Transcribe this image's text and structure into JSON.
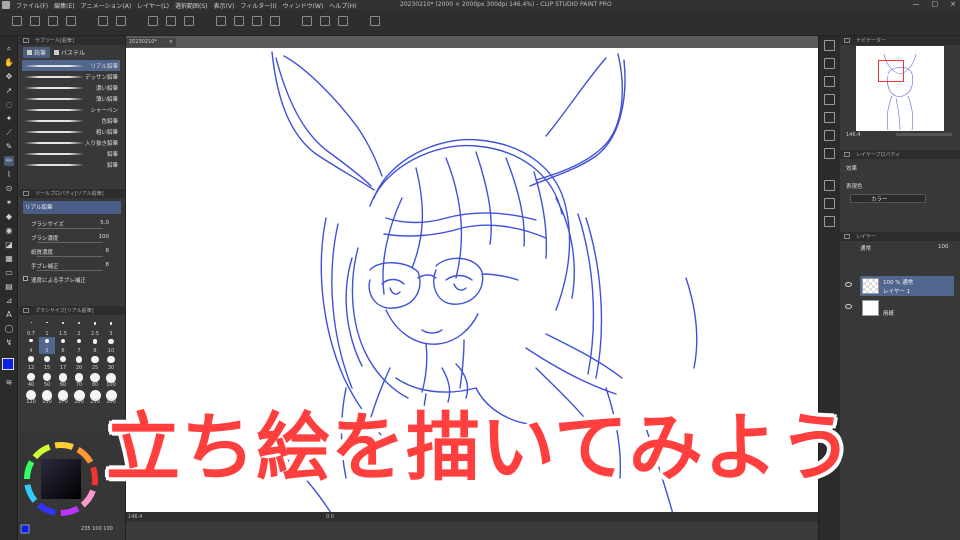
{
  "window": {
    "title": "20230210* (2000 × 2000px 300dpi 146.4%) - CLIP STUDIO PAINT PRO",
    "controls": [
      "—",
      "□",
      "×"
    ]
  },
  "menu": {
    "items": [
      "ファイル(F)",
      "編集(E)",
      "アニメーション(A)",
      "レイヤー(L)",
      "選択範囲(S)",
      "表示(V)",
      "フィルター(I)",
      "ウィンドウ(W)",
      "ヘルプ(H)"
    ]
  },
  "subtool": {
    "panel_title": "サブツール[鉛筆]",
    "tabs": [
      {
        "label": "鉛筆",
        "active": true
      },
      {
        "label": "パステル",
        "active": false
      }
    ],
    "brushes": [
      {
        "label": "リアル鉛筆",
        "active": true
      },
      {
        "label": "デッサン鉛筆",
        "active": false
      },
      {
        "label": "濃い鉛筆",
        "active": false
      },
      {
        "label": "薄い鉛筆",
        "active": false
      },
      {
        "label": "シャーペン",
        "active": false
      },
      {
        "label": "色鉛筆",
        "active": false
      },
      {
        "label": "粗い鉛筆",
        "active": false
      },
      {
        "label": "入り抜き鉛筆",
        "active": false
      },
      {
        "label": "鉛筆",
        "active": false
      },
      {
        "label": "鉛筆",
        "active": false
      }
    ]
  },
  "tool_property": {
    "panel_title": "ツールプロパティ[リアル鉛筆]",
    "preview_label": "リアル鉛筆",
    "rows": [
      {
        "label": "ブラシサイズ",
        "value": "5.0",
        "checkbox": false
      },
      {
        "label": "ブラシ濃度",
        "value": "100",
        "checkbox": false
      },
      {
        "label": "紙質濃度",
        "value": "8",
        "checkbox": false
      },
      {
        "label": "手ブレ補正",
        "value": "8",
        "checkbox": false
      },
      {
        "label": "速度による手ブレ補正",
        "value": "",
        "checkbox": true
      }
    ]
  },
  "brush_size": {
    "panel_title": "ブラシサイズ[リアル鉛筆]",
    "sizes": [
      "0.7",
      "1",
      "1.5",
      "2",
      "2.5",
      "3",
      "4",
      "5",
      "6",
      "7",
      "8",
      "10",
      "12",
      "15",
      "17",
      "20",
      "25",
      "30",
      "40",
      "50",
      "60",
      "70",
      "80",
      "100",
      "120",
      "150",
      "170",
      "200",
      "250",
      "300"
    ],
    "active_size": "5"
  },
  "color": {
    "main": "#0a20e8",
    "sub": "#ffffff",
    "values": "235 100 100"
  },
  "canvas": {
    "doc_tab": "20230210*",
    "zoom": "146.4",
    "sketch_color": "#2b3fd6"
  },
  "navigator": {
    "panel_title": "ナビゲーター",
    "zoom": "146.4",
    "angle": "0.0"
  },
  "layer_property": {
    "panel_title": "レイヤープロパティ",
    "effect_label": "効果",
    "express_label": "表現色",
    "express_value": "カラー"
  },
  "layers": {
    "panel_title": "レイヤー",
    "blend_mode": "通常",
    "opacity": "100",
    "items": [
      {
        "line1": "100 % 通常",
        "line2": "レイヤー 1",
        "active": true,
        "thumb": "checker"
      },
      {
        "line1": "",
        "line2": "用紙",
        "active": false,
        "thumb": "white"
      }
    ]
  },
  "caption": {
    "text": "立ち絵を描いてみよう",
    "color": "#ff3e3e"
  }
}
